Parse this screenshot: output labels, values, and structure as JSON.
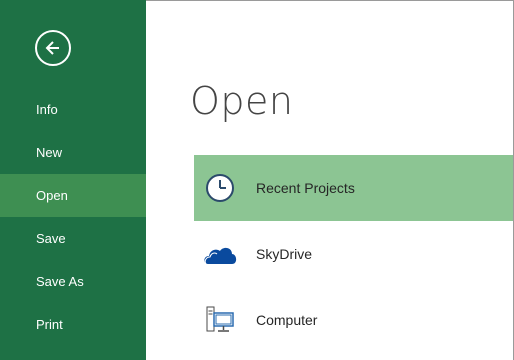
{
  "sidebar": {
    "back_icon": "back-arrow-circle-icon",
    "items": [
      {
        "label": "Info"
      },
      {
        "label": "New"
      },
      {
        "label": "Open",
        "active": true
      },
      {
        "label": "Save"
      },
      {
        "label": "Save As"
      },
      {
        "label": "Print"
      }
    ]
  },
  "main": {
    "title": "Open",
    "places": [
      {
        "label": "Recent Projects",
        "icon": "clock-icon",
        "selected": true
      },
      {
        "label": "SkyDrive",
        "icon": "cloud-icon"
      },
      {
        "label": "Computer",
        "icon": "computer-icon"
      }
    ]
  },
  "colors": {
    "sidebar_bg": "#1e7145",
    "sidebar_active": "#3e8f52",
    "selected_place": "#8cc593",
    "title_text": "#444444",
    "skydrive_blue": "#0a4a9e"
  }
}
